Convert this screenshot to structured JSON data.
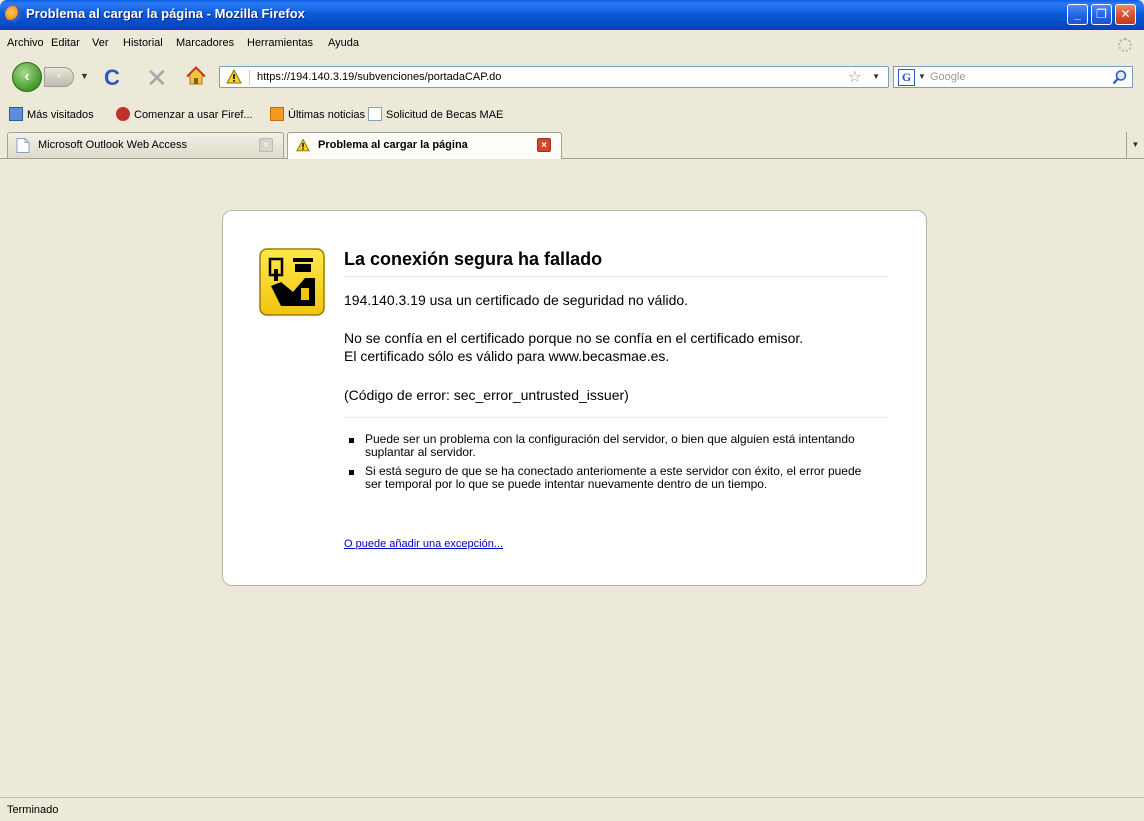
{
  "window": {
    "title": "Problema al cargar la página - Mozilla Firefox",
    "minimize": "_",
    "restore": "❐",
    "close": "✕"
  },
  "menu": {
    "items": [
      "Archivo",
      "Editar",
      "Ver",
      "Historial",
      "Marcadores",
      "Herramientas",
      "Ayuda"
    ]
  },
  "nav": {
    "url": "https://194.140.3.19/subvenciones/portadaCAP.do",
    "search_placeholder": "Google",
    "search_engine_icon": "G"
  },
  "bookmarks": [
    {
      "label": "Más visitados",
      "icon": "most-visited-icon"
    },
    {
      "label": "Comenzar a usar Firef...",
      "icon": "firefox-start-icon"
    },
    {
      "label": "Últimas noticias",
      "icon": "rss-feed-icon"
    },
    {
      "label": "Solicitud de Becas MAE",
      "icon": "page-icon"
    }
  ],
  "tabs": [
    {
      "label": "Microsoft Outlook Web Access",
      "active": false
    },
    {
      "label": "Problema al cargar la página",
      "active": true
    }
  ],
  "error": {
    "title": "La conexión segura ha fallado",
    "line1": "194.140.3.19 usa un certificado de seguridad no válido.",
    "line2": "No se confía en el certificado porque no se confía en el certificado emisor.",
    "line3": "El certificado sólo es válido para www.becasmae.es.",
    "code": "(Código de error: sec_error_untrusted_issuer)",
    "bullets": [
      "Puede ser un problema con la configuración del servidor, o bien que alguien está intentando suplantar al servidor.",
      "Si está seguro de que se ha conectado anteriomente a este servidor con éxito, el error puede ser temporal por lo que se puede intentar nuevamente dentro de un tiempo."
    ],
    "exception_link": "O puede añadir una excepción..."
  },
  "status": {
    "text": "Terminado"
  },
  "colors": {
    "titlebar": "#0548C6",
    "background": "#ECE9D8",
    "link": "#0000cc",
    "warning_yellow": "#F5D328"
  }
}
